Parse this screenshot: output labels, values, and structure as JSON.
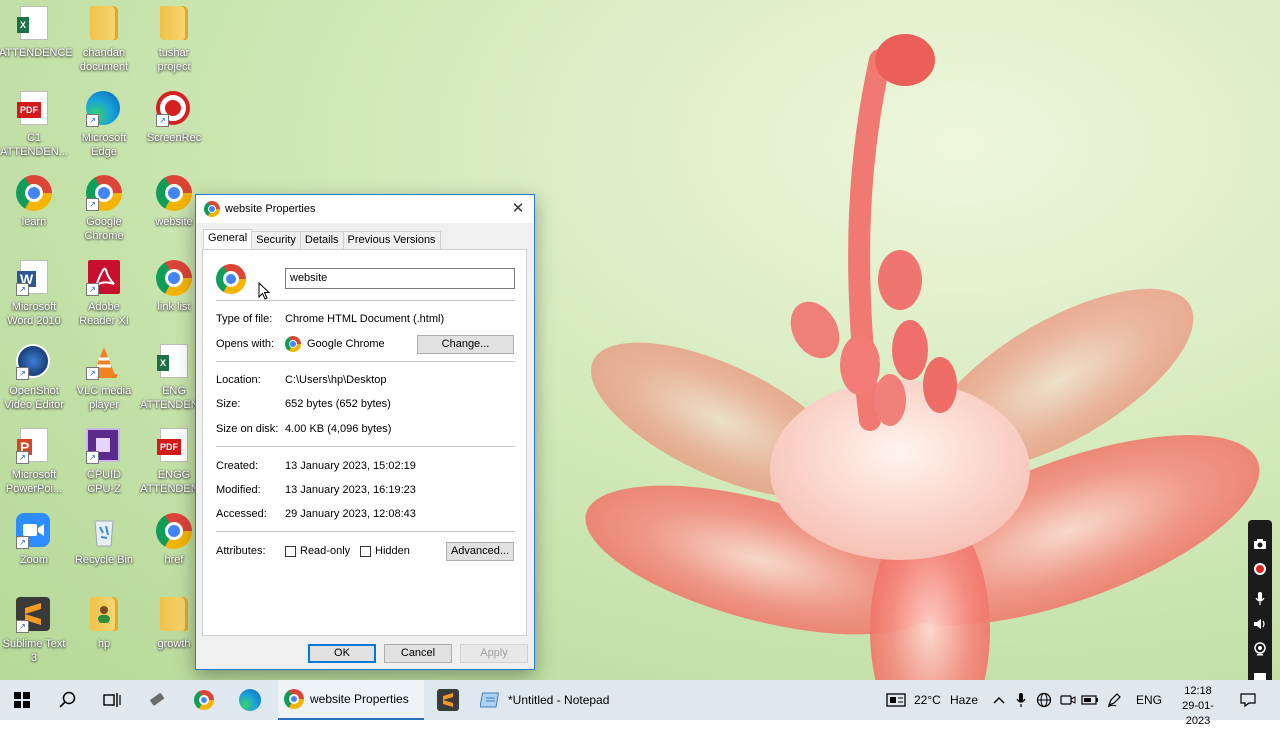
{
  "desktop": {
    "icons": [
      {
        "label": "ATTENDENCE",
        "type": "excel"
      },
      {
        "label": "chandan\ndocument",
        "type": "folder"
      },
      {
        "label": "tushar\nproject",
        "type": "folder"
      },
      {
        "label": "C1\nATTENDEN...",
        "type": "pdf"
      },
      {
        "label": "Microsoft\nEdge",
        "type": "edge"
      },
      {
        "label": "ScreenRec",
        "type": "screenrec"
      },
      {
        "label": "learn",
        "type": "chrome"
      },
      {
        "label": "Google\nChrome",
        "type": "chrome"
      },
      {
        "label": "website",
        "type": "chrome"
      },
      {
        "label": "Microsoft\nWord 2010",
        "type": "word"
      },
      {
        "label": "Adobe\nReader XI",
        "type": "adobe"
      },
      {
        "label": "link list",
        "type": "chrome"
      },
      {
        "label": "OpenShot\nVideo Editor",
        "type": "openshot"
      },
      {
        "label": "VLC media\nplayer",
        "type": "vlc"
      },
      {
        "label": "ENG\nATTENDEN...",
        "type": "excel"
      },
      {
        "label": "Microsoft\nPowerPoi...",
        "type": "powerpoint"
      },
      {
        "label": "CPUID\nCPU-Z",
        "type": "cpuz"
      },
      {
        "label": "ENGG\nATTENDEN...",
        "type": "pdf"
      },
      {
        "label": "Zoom",
        "type": "zoom"
      },
      {
        "label": "Recycle Bin",
        "type": "recycle"
      },
      {
        "label": "href",
        "type": "chrome"
      },
      {
        "label": "Sublime Text\n3",
        "type": "sublime"
      },
      {
        "label": "hp",
        "type": "user-folder"
      },
      {
        "label": "growth",
        "type": "folder"
      }
    ],
    "pdf_tag": "PDF",
    "excel_tag": "X",
    "word_tag": "W",
    "ppt_tag": "P"
  },
  "dialog": {
    "title": "website Properties",
    "close": "✕",
    "tabs": [
      "General",
      "Security",
      "Details",
      "Previous Versions"
    ],
    "active_tab": "General",
    "name_value": "website",
    "type_label": "Type of file:",
    "type_value": "Chrome HTML Document (.html)",
    "opens_label": "Opens with:",
    "opens_value": "Google Chrome",
    "change_button": "Change...",
    "location_label": "Location:",
    "location_value": "C:\\Users\\hp\\Desktop",
    "size_label": "Size:",
    "size_value": "652 bytes (652 bytes)",
    "disk_label": "Size on disk:",
    "disk_value": "4.00 KB (4,096 bytes)",
    "created_label": "Created:",
    "created_value": "13 January 2023, 15:02:19",
    "modified_label": "Modified:",
    "modified_value": "13 January 2023, 16:19:23",
    "accessed_label": "Accessed:",
    "accessed_value": "29 January 2023, 12:08:43",
    "attributes_label": "Attributes:",
    "readonly_label": "Read-only",
    "hidden_label": "Hidden",
    "advanced_button": "Advanced...",
    "ok_button": "OK",
    "cancel_button": "Cancel",
    "apply_button": "Apply"
  },
  "taskbar": {
    "tasks": [
      {
        "label": "website Properties",
        "icon": "chrome-icon"
      },
      {
        "label": "*Untitled - Notepad",
        "icon": "notepad-icon"
      }
    ],
    "weather_temp": "22°C",
    "weather_text": "Haze",
    "language": "ENG",
    "time": "12:18",
    "date": "29-01-2023"
  },
  "colors": {
    "accent": "#0078d7",
    "title_border": "#2b7bd6",
    "taskbar_bg": "#dfe7ef"
  }
}
